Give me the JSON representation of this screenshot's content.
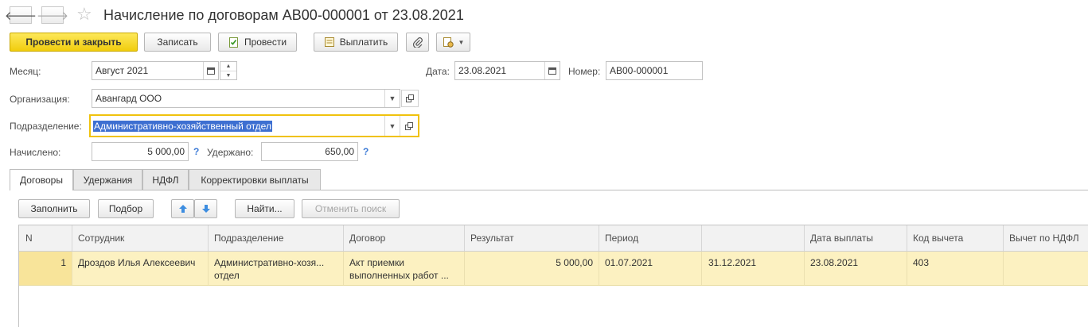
{
  "header": {
    "title": "Начисление по договорам АВ00-000001 от 23.08.2021",
    "back_glyph": "🡐",
    "forward_glyph": "🡒",
    "star_glyph": "☆"
  },
  "toolbar": {
    "post_close": "Провести и закрыть",
    "save": "Записать",
    "post": "Провести",
    "pay": "Выплатить"
  },
  "form": {
    "month_label": "Месяц:",
    "month_value": "Август 2021",
    "date_label": "Дата:",
    "date_value": "23.08.2021",
    "number_label": "Номер:",
    "number_value": "АВ00-000001",
    "org_label": "Организация:",
    "org_value": "Авангард ООО",
    "dept_label": "Подразделение:",
    "dept_value": "Административно-хозяйственный отдел",
    "accrued_label": "Начислено:",
    "accrued_value": "5 000,00",
    "withheld_label": "Удержано:",
    "withheld_value": "650,00",
    "help_glyph": "?"
  },
  "tabs": [
    {
      "label": "Договоры"
    },
    {
      "label": "Удержания"
    },
    {
      "label": "НДФЛ"
    },
    {
      "label": "Корректировки выплаты"
    }
  ],
  "grid_toolbar": {
    "fill": "Заполнить",
    "select": "Подбор",
    "find": "Найти...",
    "cancel_search": "Отменить поиск"
  },
  "table": {
    "columns": [
      "N",
      "Сотрудник",
      "Подразделение",
      "Договор",
      "Результат",
      "Период",
      "",
      "Дата выплаты",
      "Код вычета",
      "Вычет по НДФЛ"
    ],
    "rows": [
      {
        "n": "1",
        "employee": "Дроздов Илья Алексеевич",
        "department": "Административно-хозя... отдел",
        "contract": "Акт приемки выполненных работ ...",
        "result": "5 000,00",
        "period_start": "01.07.2021",
        "period_end": "31.12.2021",
        "pay_date": "23.08.2021",
        "deduction_code": "403",
        "ndfl_deduction": ""
      }
    ]
  },
  "colors": {
    "primary_button": "#f1cd0d",
    "row_highlight": "#fcf1c1",
    "selection": "#3d6fd1",
    "focus_border": "#f0c20d",
    "arrow_blue": "#3d8de0"
  }
}
